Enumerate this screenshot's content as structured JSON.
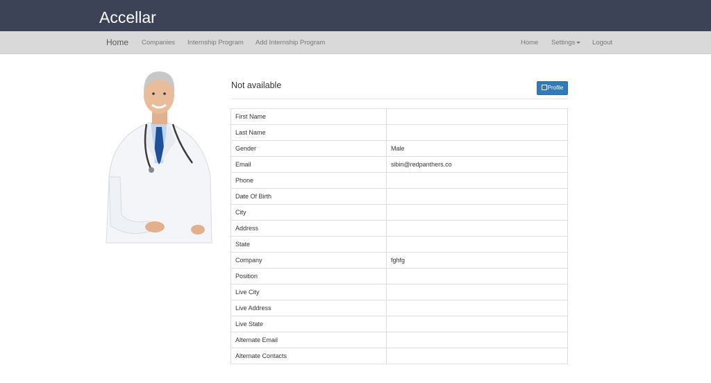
{
  "app": {
    "brand": "Accellar"
  },
  "nav": {
    "left": [
      {
        "id": "home",
        "label": "Home"
      },
      {
        "id": "companies",
        "label": "Companies"
      },
      {
        "id": "internship",
        "label": "Internship Program"
      },
      {
        "id": "add_internship",
        "label": "Add Internship Program"
      }
    ],
    "right": [
      {
        "id": "home",
        "label": "Home"
      },
      {
        "id": "settings",
        "label": "Settings"
      },
      {
        "id": "logout",
        "label": "Logout"
      }
    ]
  },
  "profile": {
    "title": "Not available",
    "button_label": "Profile",
    "photo_icon": "doctor-portrait",
    "fields": [
      {
        "label": "First Name",
        "value": ""
      },
      {
        "label": "Last Name",
        "value": ""
      },
      {
        "label": "Gender",
        "value": "Male"
      },
      {
        "label": "Email",
        "value": "sibin@redpanthers.co"
      },
      {
        "label": "Phone",
        "value": ""
      },
      {
        "label": "Date Of Birth",
        "value": ""
      },
      {
        "label": "City",
        "value": ""
      },
      {
        "label": "Address",
        "value": ""
      },
      {
        "label": "State",
        "value": ""
      },
      {
        "label": "Company",
        "value": "fghfg"
      },
      {
        "label": "Position",
        "value": ""
      },
      {
        "label": "Live City",
        "value": ""
      },
      {
        "label": "Live Address",
        "value": ""
      },
      {
        "label": "Live State",
        "value": ""
      },
      {
        "label": "Alternate Email",
        "value": ""
      },
      {
        "label": "Alternate Contacts",
        "value": ""
      }
    ]
  },
  "colors": {
    "topbar": "#3c4356",
    "navbar": "#d9d9d9",
    "primary": "#337ab7"
  }
}
